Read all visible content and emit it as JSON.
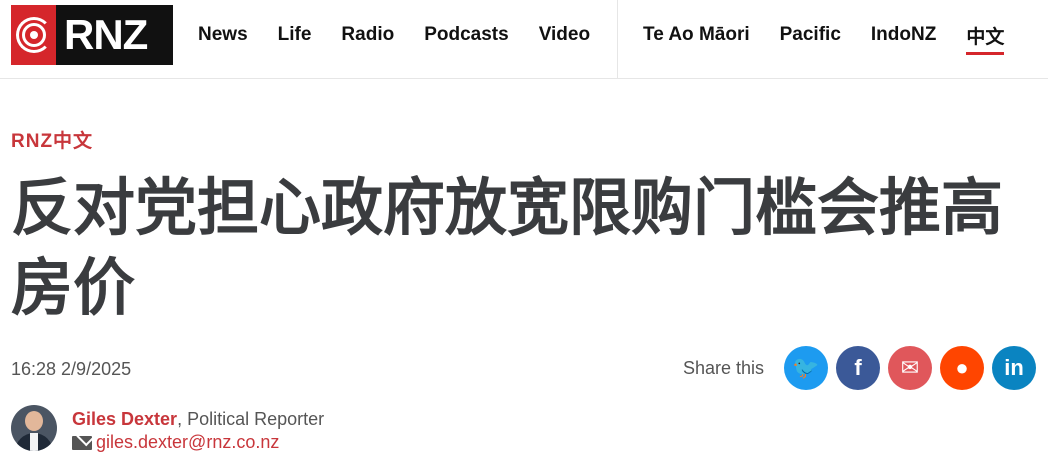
{
  "brand": {
    "logo_text": "RNZ"
  },
  "nav": {
    "left": [
      "News",
      "Life",
      "Radio",
      "Podcasts",
      "Video"
    ],
    "right": [
      "Te Ao Māori",
      "Pacific",
      "IndoNZ",
      "中文"
    ]
  },
  "article": {
    "section": "RNZ中文",
    "headline": "反对党担心政府放宽限购门槛会推高房价",
    "timestamp": "16:28 2/9/2025"
  },
  "share": {
    "label": "Share this",
    "buttons": [
      {
        "name": "twitter",
        "glyph": "🐦",
        "color": "#1d9bf0"
      },
      {
        "name": "facebook",
        "glyph": "f",
        "color": "#3b5998"
      },
      {
        "name": "email",
        "glyph": "✉",
        "color": "#e0575b"
      },
      {
        "name": "reddit",
        "glyph": "●",
        "color": "#ff4500"
      },
      {
        "name": "linkedin",
        "glyph": "in",
        "color": "#0a84c1"
      }
    ]
  },
  "author": {
    "name": "Giles Dexter",
    "role": ", Political Reporter",
    "email": "giles.dexter@rnz.co.nz"
  },
  "colors": {
    "accent": "#d5262b"
  }
}
